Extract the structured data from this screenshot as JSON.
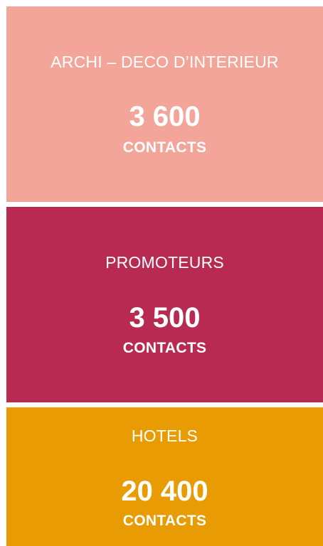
{
  "cards": [
    {
      "category": "ARCHI – DECO D’INTERIEUR",
      "count": "3 600",
      "unit": "CONTACTS",
      "color": "#F4A59A"
    },
    {
      "category": "PROMOTEURS",
      "count": "3 500",
      "unit": "CONTACTS",
      "color": "#B82A52"
    },
    {
      "category": "HOTELS",
      "count": "20 400",
      "unit": "CONTACTS",
      "color": "#E89B03"
    }
  ]
}
